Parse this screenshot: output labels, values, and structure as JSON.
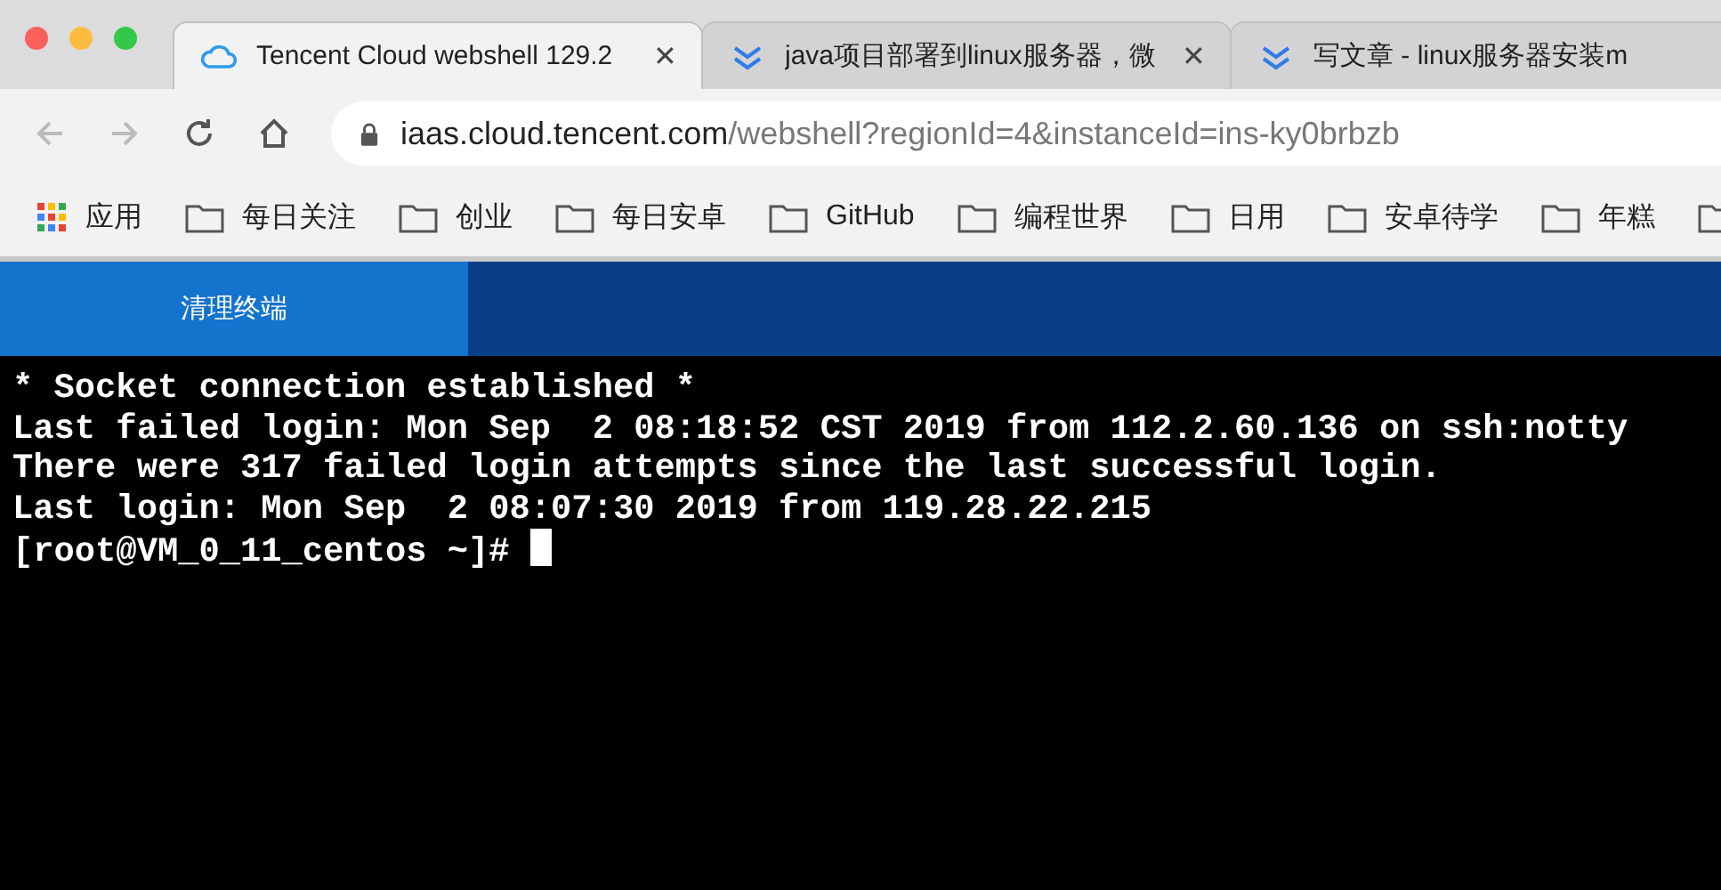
{
  "tabs": [
    {
      "title": "Tencent Cloud webshell 129.2",
      "kind": "cloud",
      "selected": true,
      "close": "✕"
    },
    {
      "title": "java项目部署到linux服务器，微",
      "kind": "feather",
      "selected": false,
      "close": "✕"
    },
    {
      "title": "写文章 - linux服务器安装m",
      "kind": "feather",
      "selected": false
    }
  ],
  "address": {
    "host": "iaas.cloud.tencent.com",
    "path": "/webshell?regionId=4&instanceId=ins-ky0brbzb"
  },
  "bookmarks": [
    {
      "kind": "apps",
      "label": "应用"
    },
    {
      "kind": "folder",
      "label": "每日关注"
    },
    {
      "kind": "folder",
      "label": "创业"
    },
    {
      "kind": "folder",
      "label": "每日安卓"
    },
    {
      "kind": "folder",
      "label": "GitHub"
    },
    {
      "kind": "folder",
      "label": "编程世界"
    },
    {
      "kind": "folder",
      "label": "日用"
    },
    {
      "kind": "folder",
      "label": "安卓待学"
    },
    {
      "kind": "folder",
      "label": "年糕"
    },
    {
      "kind": "folder"
    }
  ],
  "app_header": {
    "button": "清理终端"
  },
  "terminal": {
    "lines": [
      "* Socket connection established *",
      "Last failed login: Mon Sep  2 08:18:52 CST 2019 from 112.2.60.136 on ssh:notty",
      "There were 317 failed login attempts since the last successful login.",
      "Last login: Mon Sep  2 08:07:30 2019 from 119.28.22.215"
    ],
    "prompt": "[root@VM_0_11_centos ~]# "
  }
}
